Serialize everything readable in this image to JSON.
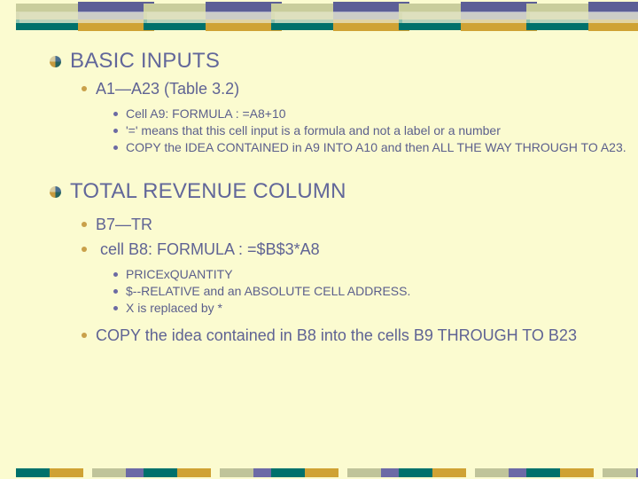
{
  "slide": {
    "background_color": "#fbfbd0",
    "text_color": "#5b5f8c",
    "accent_colors": {
      "teal": "#00716b",
      "gold": "#cfa234",
      "purple": "#5c5f96",
      "sage": "#c9cd9c"
    },
    "sections": [
      {
        "title": "BASIC INPUTS",
        "level2": [
          {
            "text": "A1—A23 (Table 3.2)",
            "level3": [
              "Cell A9:  FORMULA : =A8+10",
              "'=' means that this cell input is a formula and not a label or a number",
              "COPY the IDEA CONTAINED in A9 INTO A10 and then ALL THE WAY THROUGH TO A23."
            ]
          }
        ]
      },
      {
        "title": "TOTAL REVENUE COLUMN",
        "level2": [
          {
            "text": "B7—TR",
            "level3": []
          },
          {
            "text": "cell B8: FORMULA : =$B$3*A8",
            "level3": [
              "PRICExQUANTITY",
              "$--RELATIVE and an ABSOLUTE CELL ADDRESS.",
              "X is replaced by *"
            ]
          },
          {
            "text": "COPY the idea contained in B8 into the cells B9 THROUGH TO B23",
            "level3": []
          }
        ]
      }
    ]
  },
  "decoration": {
    "top_bar_blocks": 5,
    "bottom_bar_blocks": 5
  }
}
